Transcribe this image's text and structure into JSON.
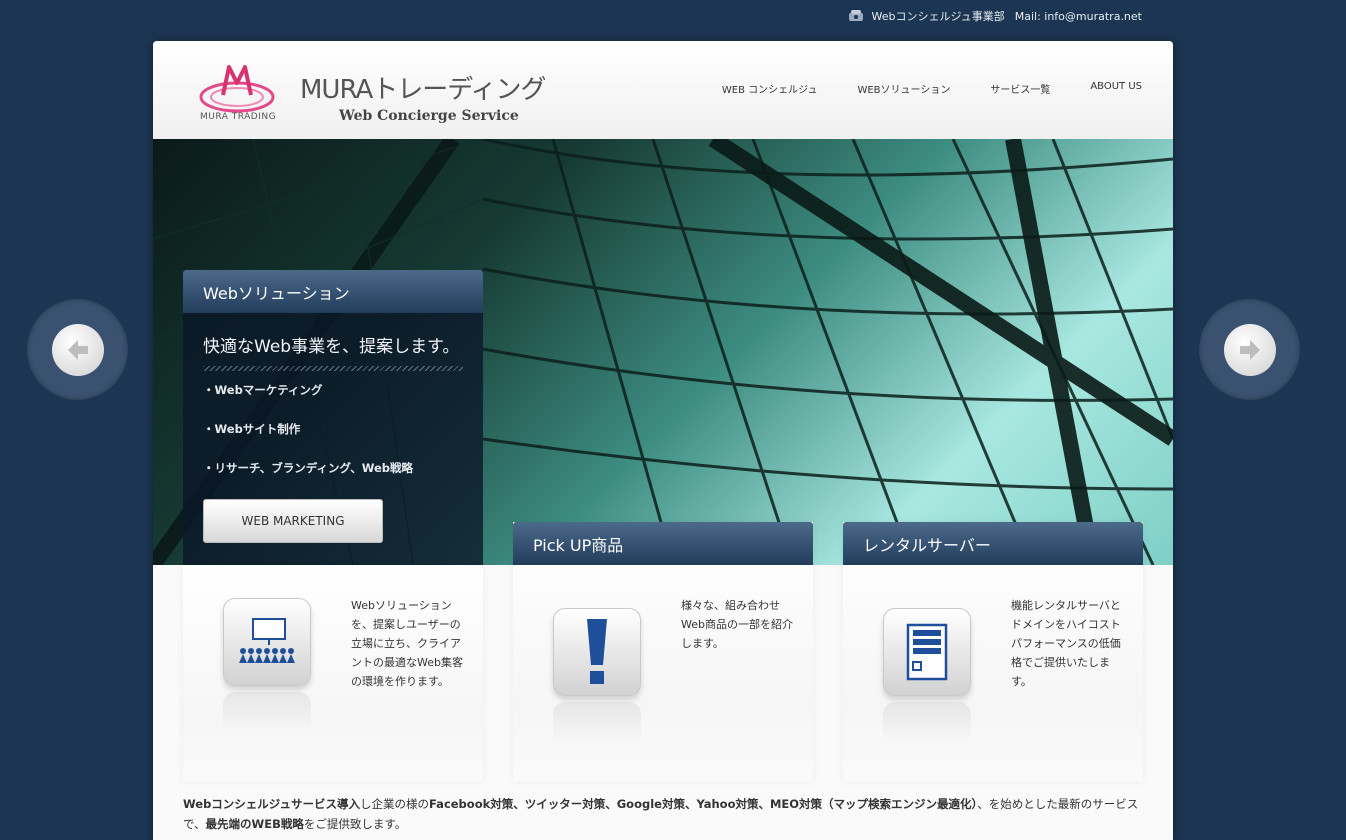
{
  "topbar": {
    "department": "Webコンシェルジュ事業部",
    "mail": "Mail: info@muratra.net",
    "phone_icon": "phone-icon"
  },
  "header": {
    "logo_mark_text": "MURA TRADING",
    "logo_name": "MURAトレーディング",
    "logo_subtitle": "Web Concierge Service",
    "nav": [
      {
        "label": "WEB コンシェルジュ"
      },
      {
        "label": "WEBソリューション"
      },
      {
        "label": "サービス一覧"
      },
      {
        "label": "ABOUT US"
      }
    ]
  },
  "hero": {
    "panel_title": "Webソリューション",
    "tagline": "快適なWeb事業を、提案します。",
    "items": [
      "・Webマーケティング",
      "・Webサイト制作",
      "・リサーチ、ブランディング、Web戦略"
    ],
    "button_label": "WEB MARKETING"
  },
  "cards": [
    {
      "title": "",
      "icon": "presentation-icon",
      "text": "Webソリューションを、提案しユーザーの立場に立ち、クライアントの最適なWeb集客の環境を作ります。"
    },
    {
      "title": "Pick UP商品",
      "icon": "exclamation-icon",
      "text": "様々な、組み合わせWeb商品の一部を紹介します。"
    },
    {
      "title": "レンタルサーバー",
      "icon": "server-icon",
      "text": "機能レンタルサーバとドメインをハイコストパフォーマンスの低価格でご提供いたします。"
    }
  ],
  "bottom": {
    "b1": "Webコンシェルジュサービス導入",
    "t1": "し企業の様の",
    "b2": "Facebook対策、ツイッター対策、Google対策、Yahoo対策、MEO対策（マップ検索エンジン最適化）",
    "t2": "、を始めとした最新のサービスで、",
    "b3": "最先端のWEB戦略",
    "t3": "をご提供致します。"
  },
  "colors": {
    "background": "#1c3552",
    "panel_head": "#233c5c",
    "accent_blue": "#1f4f9a"
  }
}
